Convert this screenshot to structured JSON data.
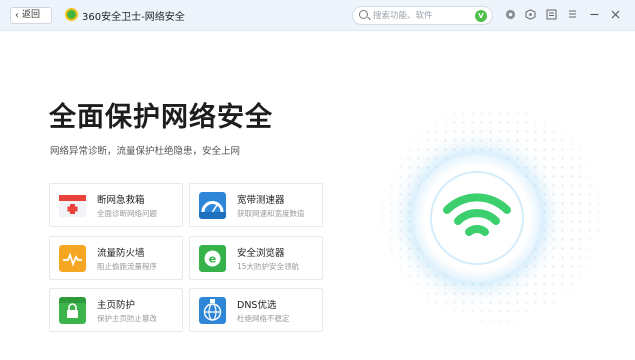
{
  "titlebar": {
    "back_label": "返回",
    "app_title": "360安全卫士-网络安全",
    "search_placeholder": "搜索功能、软件",
    "window_icons": [
      "settings-icon",
      "skin-icon",
      "menu-icon",
      "restore-icon",
      "minimize-icon",
      "close-icon"
    ]
  },
  "hero": {
    "title": "全面保护网络安全",
    "subtitle": "网络异常诊断，流量保护杜绝隐患，安全上网"
  },
  "cards": [
    {
      "title": "断网急救箱",
      "desc": "全面诊断网络问题",
      "icon": "first-aid-kit-icon",
      "color": "#e8423a"
    },
    {
      "title": "宽带测速器",
      "desc": "获取网速和宽度数值",
      "icon": "speedometer-icon",
      "color": "#2e86d8"
    },
    {
      "title": "流量防火墙",
      "desc": "阻止偷跑流量程序",
      "icon": "traffic-firewall-icon",
      "color": "#f5a623"
    },
    {
      "title": "安全浏览器",
      "desc": "15大防护安全领航",
      "icon": "browser-icon",
      "color": "#36b24a"
    },
    {
      "title": "主页防护",
      "desc": "保护主页防止篡改",
      "icon": "homepage-lock-icon",
      "color": "#3cb44b"
    },
    {
      "title": "DNS优选",
      "desc": "杜绝网络不稳定",
      "icon": "dns-globe-icon",
      "color": "#2f86d6"
    }
  ],
  "colors": {
    "accent": "#2fcb6a",
    "wifi": "#3ccf6d",
    "ring": "#bfe3f9"
  }
}
